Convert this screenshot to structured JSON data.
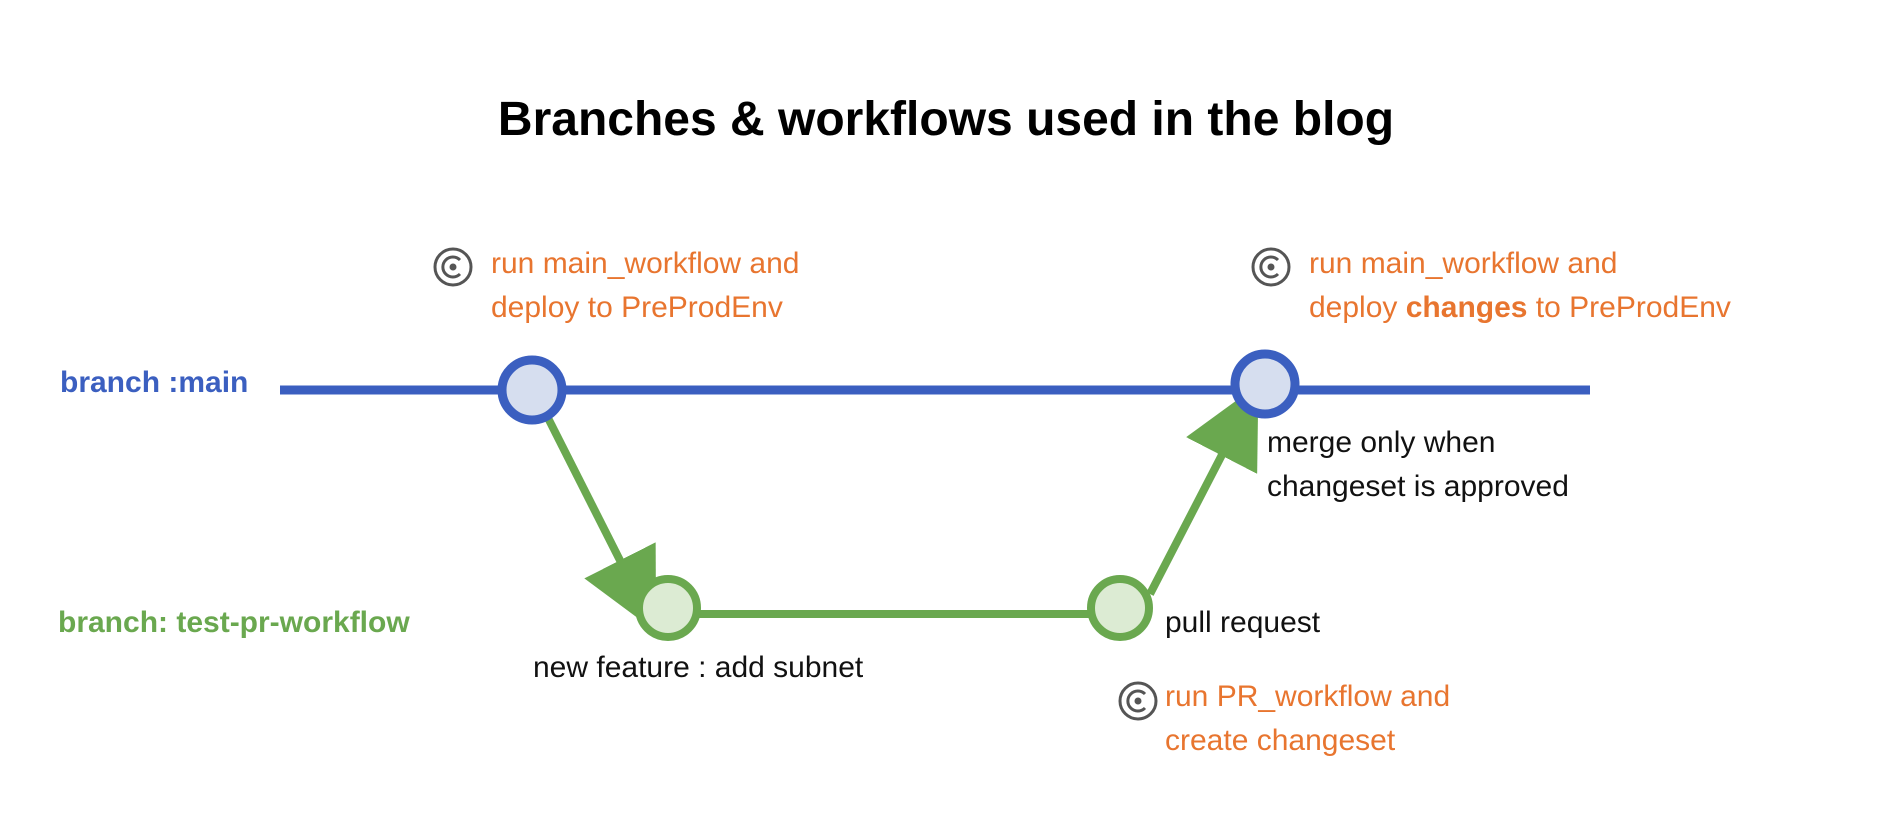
{
  "title": "Branches & workflows used in the blog",
  "branches": {
    "main": {
      "label": "branch :main",
      "color": "#3b5fc0"
    },
    "test": {
      "label": "branch: test-pr-workflow",
      "color": "#6aa84f"
    }
  },
  "annotations": {
    "first_deploy": {
      "line1": "run main_workflow and",
      "line2": "deploy to PreProdEnv"
    },
    "second_deploy": {
      "line1": "run main_workflow and",
      "line2_pre": "deploy ",
      "line2_bold": "changes",
      "line2_post": " to PreProdEnv"
    },
    "pr_workflow": {
      "line1": "run PR_workflow and",
      "line2": "create changeset"
    }
  },
  "labels": {
    "merge_line1": "merge only when",
    "merge_line2": "changeset is approved",
    "new_feature": "new feature : add subnet",
    "pull_request": "pull request"
  },
  "icons": [
    "workflow-icon",
    "workflow-icon",
    "workflow-icon"
  ],
  "colors": {
    "annotation": "#e8752f",
    "main_node_fill": "#d6deef",
    "test_node_fill": "#dcebd3"
  }
}
